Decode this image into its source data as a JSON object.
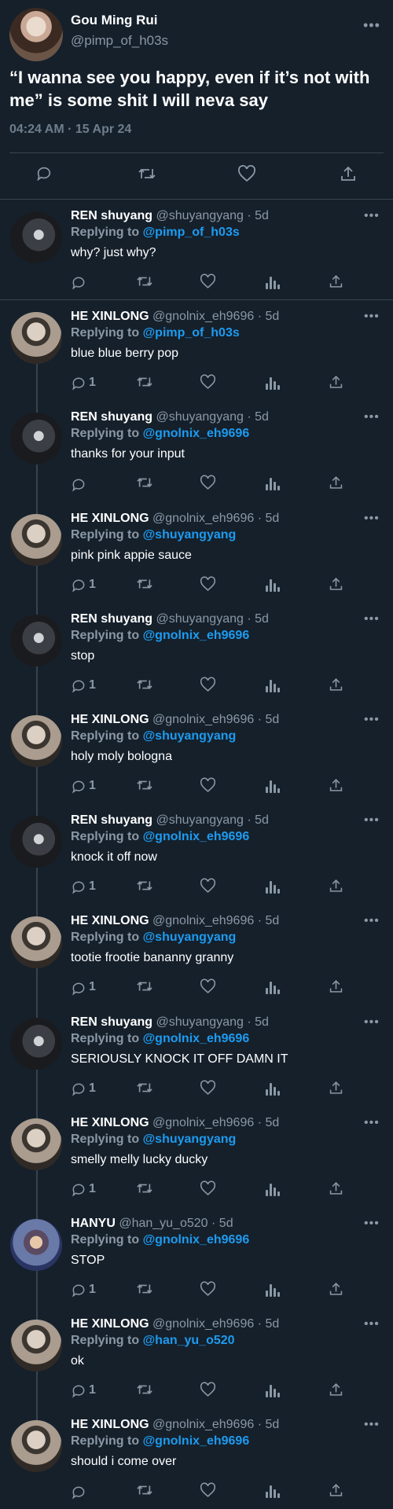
{
  "main_tweet": {
    "display_name": "Gou Ming Rui",
    "handle": "@pimp_of_h03s",
    "more": "•••",
    "text": "“I wanna see you happy, even if it’s not with me” is some shit I will neva say",
    "timestamp": "04:24 AM · 15 Apr 24"
  },
  "colors": {
    "background": "#15202b",
    "text": "#ffffff",
    "muted": "#8b98a5",
    "link": "#1d9bf0",
    "divider": "#38444d"
  },
  "icons": [
    "reply-icon",
    "retweet-icon",
    "like-icon",
    "analytics-icon",
    "share-icon",
    "more-icon"
  ],
  "replies": [
    {
      "name": "REN shuyang",
      "handle": "@shuyangyang",
      "time": "· 5d",
      "replying_label": "Replying to",
      "replying_to": "@pimp_of_h03s",
      "text": "why? just why?",
      "reply_count": "",
      "avatar": "ren"
    },
    {
      "name": "HE XINLONG",
      "handle": "@gnolnix_eh9696",
      "time": "· 5d",
      "replying_label": "Replying to",
      "replying_to": "@pimp_of_h03s",
      "text": "blue blue berry pop",
      "reply_count": "1",
      "avatar": "he"
    },
    {
      "name": "REN shuyang",
      "handle": "@shuyangyang",
      "time": "· 5d",
      "replying_label": "Replying to",
      "replying_to": "@gnolnix_eh9696",
      "text": "thanks for your input",
      "reply_count": "",
      "avatar": "ren"
    },
    {
      "name": "HE XINLONG",
      "handle": "@gnolnix_eh9696",
      "time": "· 5d",
      "replying_label": "Replying to",
      "replying_to": "@shuyangyang",
      "text": "pink pink appie sauce",
      "reply_count": "1",
      "avatar": "he"
    },
    {
      "name": "REN shuyang",
      "handle": "@shuyangyang",
      "time": "· 5d",
      "replying_label": "Replying to",
      "replying_to": "@gnolnix_eh9696",
      "text": "stop",
      "reply_count": "1",
      "avatar": "ren"
    },
    {
      "name": "HE XINLONG",
      "handle": "@gnolnix_eh9696",
      "time": "· 5d",
      "replying_label": "Replying to",
      "replying_to": "@shuyangyang",
      "text": "holy moly bologna",
      "reply_count": "1",
      "avatar": "he"
    },
    {
      "name": "REN shuyang",
      "handle": "@shuyangyang",
      "time": "· 5d",
      "replying_label": "Replying to",
      "replying_to": "@gnolnix_eh9696",
      "text": "knock it off now",
      "reply_count": "1",
      "avatar": "ren"
    },
    {
      "name": "HE XINLONG",
      "handle": "@gnolnix_eh9696",
      "time": "· 5d",
      "replying_label": "Replying to",
      "replying_to": "@shuyangyang",
      "text": "tootie frootie bananny granny",
      "reply_count": "1",
      "avatar": "he"
    },
    {
      "name": "REN shuyang",
      "handle": "@shuyangyang",
      "time": "· 5d",
      "replying_label": "Replying to",
      "replying_to": "@gnolnix_eh9696",
      "text": "SERIOUSLY KNOCK IT OFF DAMN IT",
      "reply_count": "1",
      "avatar": "ren"
    },
    {
      "name": "HE XINLONG",
      "handle": "@gnolnix_eh9696",
      "time": "· 5d",
      "replying_label": "Replying to",
      "replying_to": "@shuyangyang",
      "text": "smelly melly lucky ducky",
      "reply_count": "1",
      "avatar": "he"
    },
    {
      "name": "HANYU",
      "handle": "@han_yu_o520",
      "time": "· 5d",
      "replying_label": "Replying to",
      "replying_to": "@gnolnix_eh9696",
      "text": "STOP",
      "reply_count": "1",
      "avatar": "hanyu"
    },
    {
      "name": "HE XINLONG",
      "handle": "@gnolnix_eh9696",
      "time": "· 5d",
      "replying_label": "Replying to",
      "replying_to": "@han_yu_o520",
      "text": "ok",
      "reply_count": "1",
      "avatar": "he"
    },
    {
      "name": "HE XINLONG",
      "handle": "@gnolnix_eh9696",
      "time": "· 5d",
      "replying_label": "Replying to",
      "replying_to": "@gnolnix_eh9696",
      "text": "should i come over",
      "reply_count": "",
      "avatar": "he"
    }
  ]
}
